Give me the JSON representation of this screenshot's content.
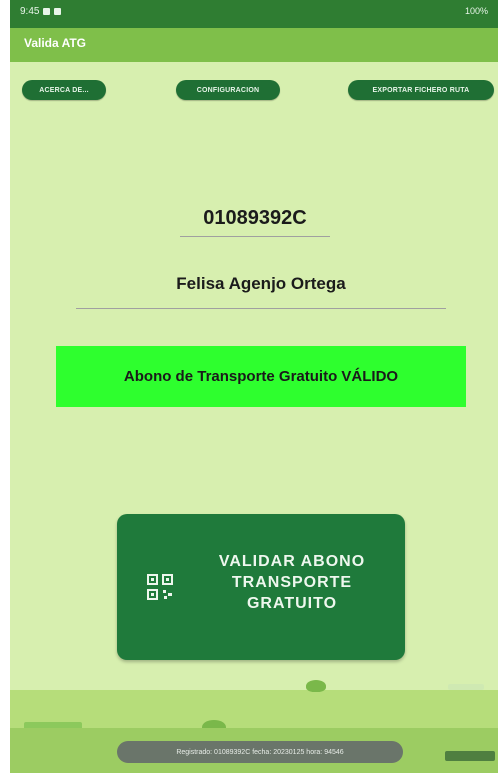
{
  "status_bar": {
    "time": "9:45",
    "battery": "100%"
  },
  "app_bar": {
    "title": "Valida ATG"
  },
  "toolbar": {
    "about_label": "ACERCA DE...",
    "config_label": "CONFIGURACION",
    "export_label": "EXPORTAR FICHERO RUTA"
  },
  "form": {
    "dni_value": "01089392C",
    "name_value": "Felisa Agenjo Ortega"
  },
  "result": {
    "status_text": "Abono de Transporte Gratuito VÁLIDO",
    "status_color": "#2eff2e"
  },
  "actions": {
    "validate_line1": "VALIDAR ABONO",
    "validate_line2": "TRANSPORTE",
    "validate_line3": "GRATUITO",
    "validate_icon": "qr-scan-icon"
  },
  "toast": {
    "text": "Registrado: 01089392C fecha: 20230125 hora: 94546"
  },
  "colors": {
    "app_bar": "#7fbf4a",
    "status_bar": "#2f7d32",
    "primary_button": "#1f7a3b",
    "background": "#d7efaf"
  }
}
